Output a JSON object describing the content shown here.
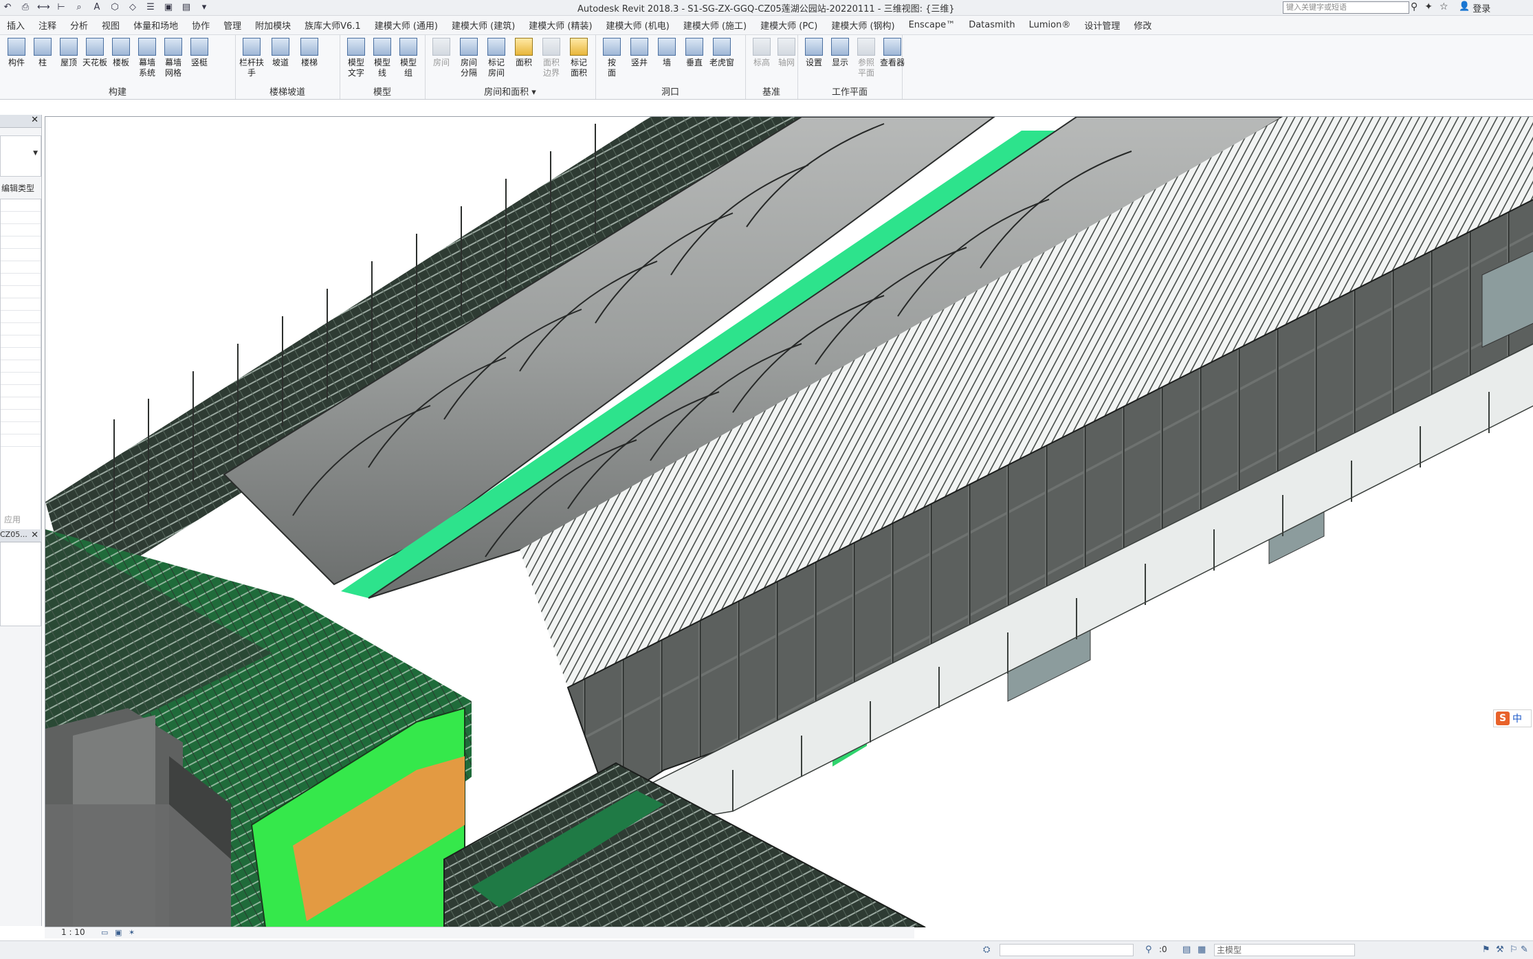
{
  "titlebar": {
    "title": "Autodesk Revit 2018.3 -     S1-SG-ZX-GGQ-CZ05莲湖公园站-20220111 - 三维视图: {三维}",
    "search_placeholder": "键入关键字或短语",
    "login": "登录"
  },
  "tabs": [
    "插入",
    "注释",
    "分析",
    "视图",
    "体量和场地",
    "协作",
    "管理",
    "附加模块",
    "族库大师V6.1",
    "建模大师 (通用)",
    "建模大师 (建筑)",
    "建模大师 (精装)",
    "建模大师 (机电)",
    "建模大师 (施工)",
    "建模大师 (PC)",
    "建模大师 (钢构)",
    "Enscape™",
    "Datasmith",
    "Lumion®",
    "设计管理",
    "修改"
  ],
  "ribbon": {
    "panels": [
      {
        "title": "构建",
        "tools": [
          "构件",
          "柱",
          "屋顶",
          "天花板",
          "楼板",
          "幕墙\n系统",
          "幕墙\n网格",
          "竖梃"
        ]
      },
      {
        "title": "楼梯坡道",
        "tools": [
          "栏杆扶手",
          "坡道",
          "楼梯"
        ]
      },
      {
        "title": "模型",
        "tools": [
          "模型\n文字",
          "模型\n线",
          "模型\n组"
        ]
      },
      {
        "title": "房间和面积 ▾",
        "tools": [
          "房间",
          "房间\n分隔",
          "标记\n房间",
          "面积",
          "面积\n边界",
          "标记\n面积"
        ]
      },
      {
        "title": "洞口",
        "tools": [
          "按\n面",
          "竖井",
          "墙",
          "垂直",
          "老虎窗"
        ]
      },
      {
        "title": "基准",
        "tools": [
          "标高",
          "轴网"
        ]
      },
      {
        "title": "工作平面",
        "tools": [
          "设置",
          "显示",
          "参照\n平面",
          "查看器"
        ]
      }
    ]
  },
  "left_panel": {
    "edit_type": "编辑类型",
    "apply": "应用",
    "project_browser_tab": "CZ05..."
  },
  "viewbar": {
    "scale": "1 : 10"
  },
  "statusbar": {
    "zero": ":0",
    "model": "主模型"
  },
  "ime": {
    "mode": "中"
  }
}
